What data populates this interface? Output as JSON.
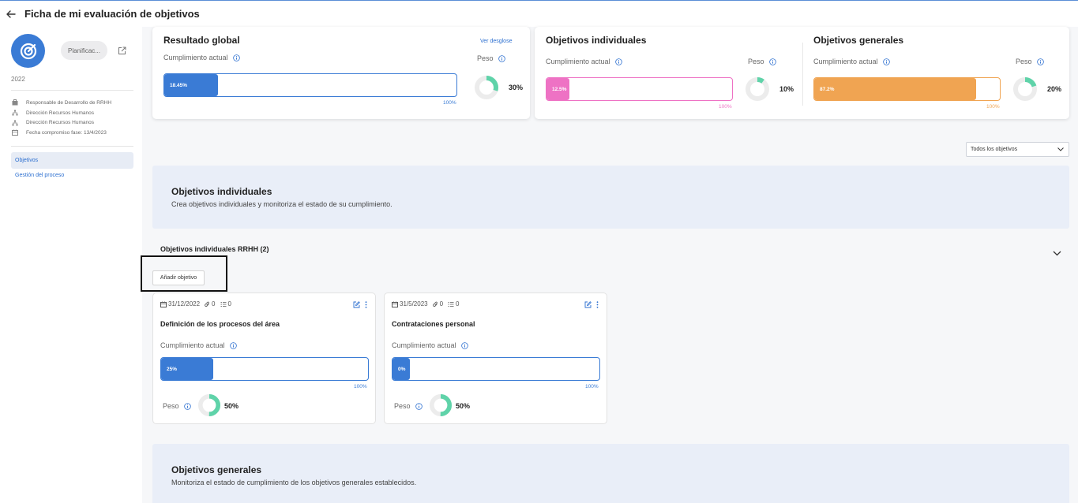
{
  "header": {
    "title": "Ficha de mi evaluación de objetivos"
  },
  "sidebar": {
    "phase": "Planificac...",
    "year": "2022",
    "meta": [
      {
        "icon": "briefcase-icon",
        "text": "Responsable de Desarrollo de RRHH"
      },
      {
        "icon": "org-chart-icon",
        "text": "Dirección Recursos Humanos"
      },
      {
        "icon": "org-chart-icon",
        "text": "Dirección Recursos Humanos"
      },
      {
        "icon": "calendar-icon",
        "text": "Fecha compromiso fase: 13/4/2023"
      }
    ],
    "nav": [
      {
        "label": "Objetivos",
        "active": true
      },
      {
        "label": "Gestión del proceso",
        "active": false
      }
    ]
  },
  "summary": {
    "global": {
      "title": "Resultado global",
      "breakdown_link": "Ver desglose",
      "current_label": "Cumplimiento actual",
      "value_label": "18.45%",
      "value": 18.45,
      "max_label": "100%",
      "weight_label": "Peso",
      "weight_label_text": "30%",
      "weight": 30,
      "color": "#3a7bd5"
    },
    "individual": {
      "title": "Objetivos individuales",
      "current_label": "Cumplimiento actual",
      "value_label": "12.5%",
      "value": 12.5,
      "max_label": "100%",
      "weight_label": "Peso",
      "weight_label_text": "10%",
      "weight": 10,
      "color": "#ee72c4"
    },
    "general": {
      "title": "Objetivos generales",
      "current_label": "Cumplimiento actual",
      "value_label": "87.2%",
      "value": 87.2,
      "max_label": "100%",
      "weight_label": "Peso",
      "weight_label_text": "20%",
      "weight": 20,
      "color": "#f0a452"
    }
  },
  "filter": {
    "selected": "Todos los objetivos"
  },
  "individual_section": {
    "title": "Objetivos individuales",
    "subtitle": "Crea objetivos individuales y monitoriza el estado de su cumplimiento.",
    "group_title": "Objetivos individuales RRHH (2)",
    "add_button": "Añadir objetivo"
  },
  "objectives": [
    {
      "date": "31/12/2022",
      "attachments": "0",
      "subtasks": "0",
      "title": "Definición de los procesos del área",
      "current_label": "Cumplimiento actual",
      "value_label": "25%",
      "value": 25,
      "max_label": "100%",
      "weight_label": "Peso",
      "weight_label_text": "50%",
      "weight": 50
    },
    {
      "date": "31/5/2023",
      "attachments": "0",
      "subtasks": "0",
      "title": "Contrataciones personal",
      "current_label": "Cumplimiento actual",
      "value_label": "0%",
      "value": 0,
      "max_label": "100%",
      "weight_label": "Peso",
      "weight_label_text": "50%",
      "weight": 50
    }
  ],
  "general_section": {
    "title": "Objetivos generales",
    "subtitle": "Monitoriza el estado de cumplimiento de los objetivos generales establecidos."
  },
  "colors": {
    "accent": "#3a7bd5",
    "donut": "#5fd3a9",
    "donut_track": "#ececec"
  }
}
